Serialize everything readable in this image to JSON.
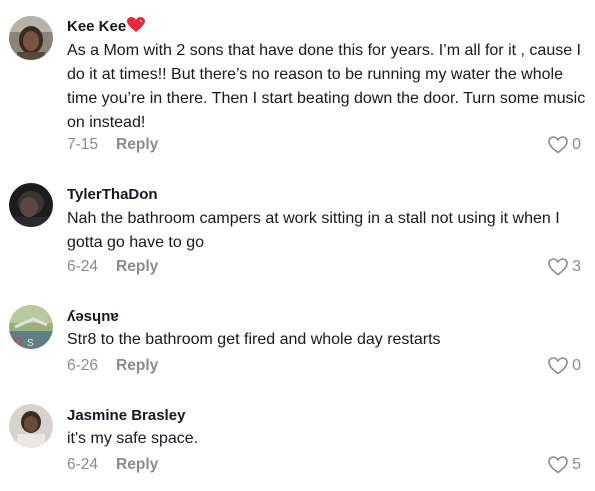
{
  "comments": [
    {
      "author": "Kee Kee",
      "author_badge": "heart-emoji",
      "text": "As a Mom with 2 sons that have done this for years. I’m all for it , cause I do it at times!! But there’s no reason to be running my water the whole time you’re in there. Then I start beating down the door. Turn some music on instead!",
      "date": "7-15",
      "reply_label": "Reply",
      "likes": "0"
    },
    {
      "author": "TylerThaDon",
      "text": "Nah the bathroom campers at work sitting in a stall not using it when I gotta go have to go",
      "date": "6-24",
      "reply_label": "Reply",
      "likes": "3"
    },
    {
      "author": "ʎǝsɥnɐ",
      "text": "Str8 to the bathroom get fired and whole day restarts",
      "date": "6-26",
      "reply_label": "Reply",
      "likes": "0"
    },
    {
      "author": "Jasmine Brasley",
      "text": "it's my safe space.",
      "date": "6-24",
      "reply_label": "Reply",
      "likes": "5"
    }
  ],
  "colors": {
    "text_primary": "#161823",
    "text_secondary": "#8a8b91",
    "heart_badge": "#e8283c"
  }
}
